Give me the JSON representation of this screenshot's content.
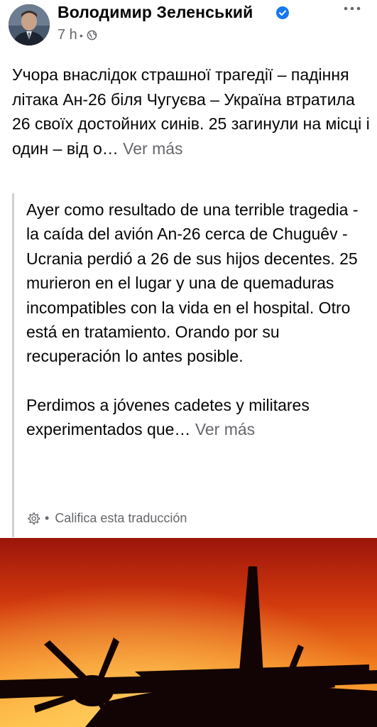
{
  "post": {
    "author": "Володимир Зеленський",
    "time": "7 h",
    "separator": "•",
    "text": "Учора внаслідок страшної трагедії – падіння літака Ан-26 біля Чугуєва – Україна втратила 26 своїх достойних синів. 25 загинули на місці і один – від о…",
    "see_more": "Ver más"
  },
  "translation": {
    "paragraph1": "Ayer como resultado de una terrible tragedia - la caída del avión An-26 cerca de Chuguêv - Ucrania perdió a 26 de sus hijos decentes. 25 murieron en el lugar y una de quemaduras incompatibles con la vida en el hospital. Otro está en tratamiento. Orando por su recuperación lo antes posible.",
    "paragraph2": "Perdimos a jóvenes cadetes y militares experimentados que…",
    "see_more": "Ver más",
    "rate_separator": "•",
    "rate_label": "Califica esta traducción"
  },
  "icons": {
    "verified": "verified-badge-icon",
    "globe": "globe-icon",
    "more": "more-options-icon",
    "gear": "gear-icon"
  },
  "colors": {
    "verified_blue": "#1877f2",
    "secondary_text": "#65676b",
    "sky_top": "#a9190c",
    "sky_bottom": "#ffb53d"
  }
}
